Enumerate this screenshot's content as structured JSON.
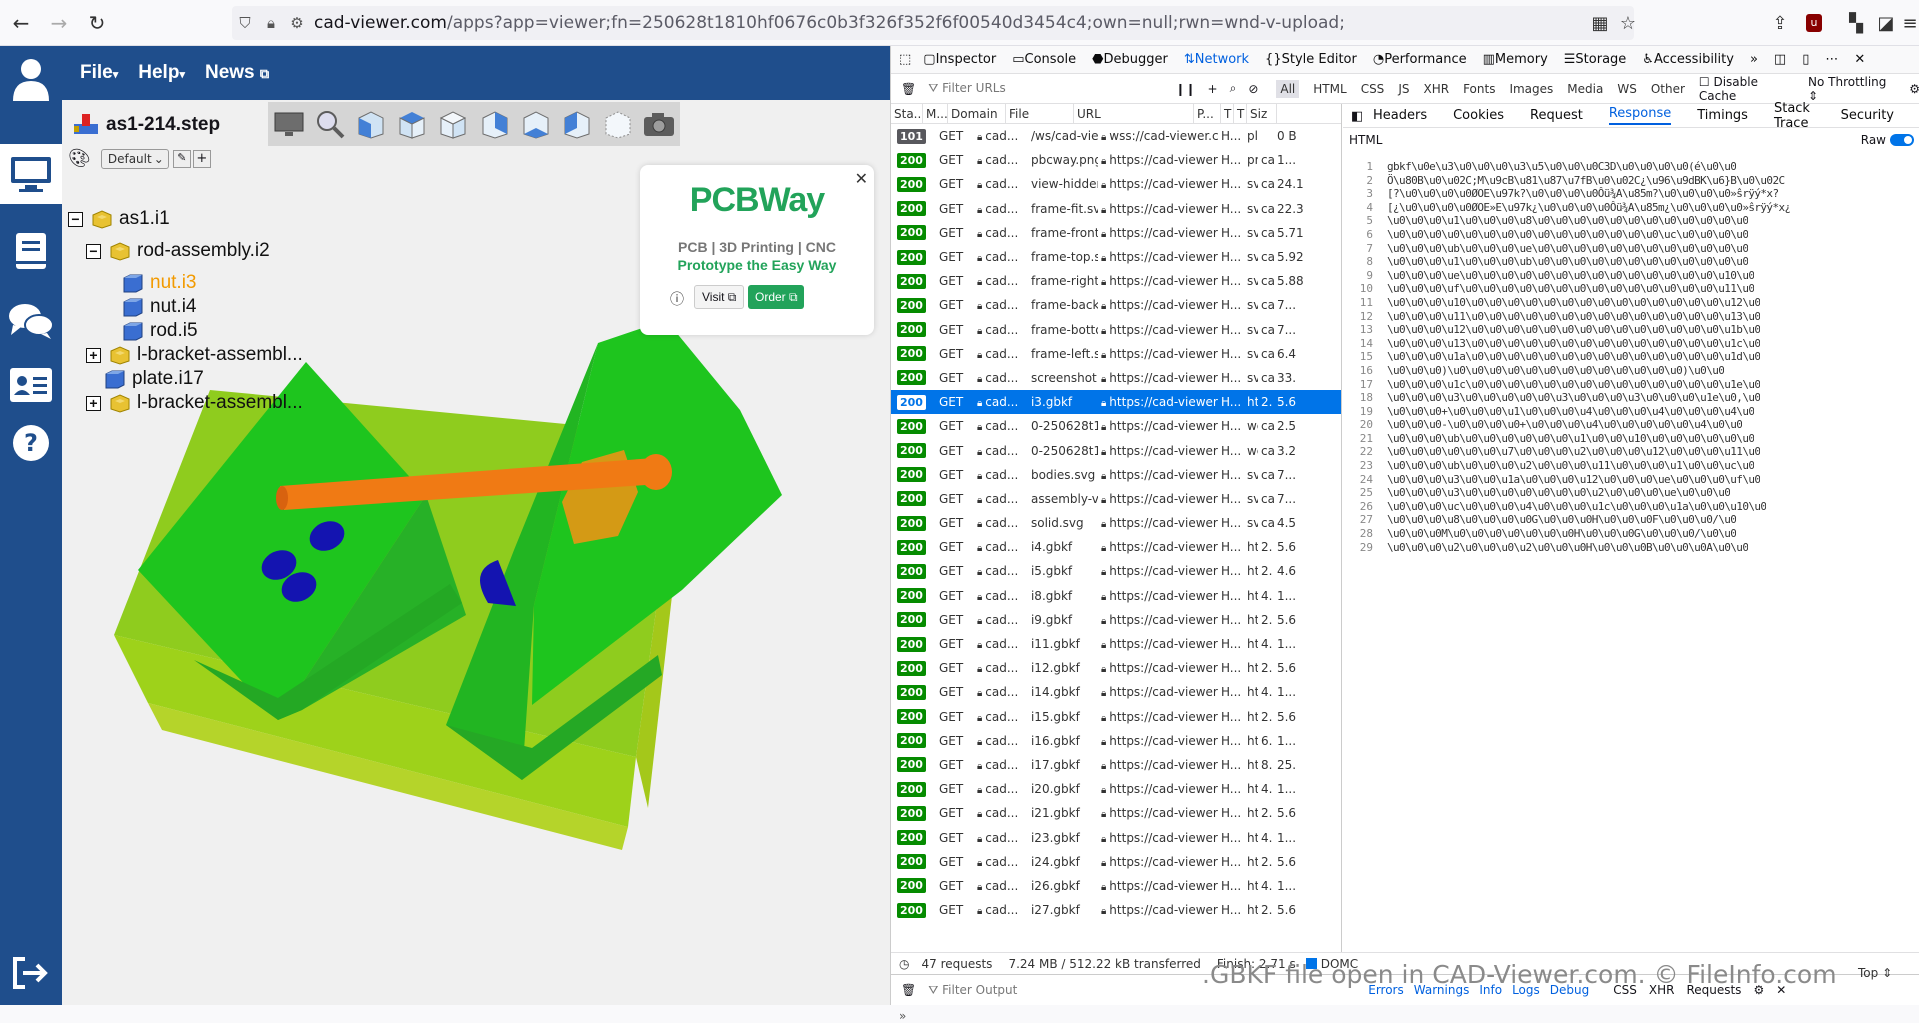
{
  "browser": {
    "url_host": "cad-viewer.com",
    "url_rest": "/apps?app=viewer;fn=250628t1810hf0676c0b3f326f352f6f00540d3454c4;own=null;rwn=wnd-v-upload;"
  },
  "app": {
    "menu": [
      {
        "label": "File"
      },
      {
        "label": "Help"
      },
      {
        "label": "News"
      }
    ],
    "file_name": "as1-214.step",
    "style_select": "Default",
    "tree": [
      {
        "label": "as1.i1"
      },
      {
        "label": "rod-assembly.i2"
      },
      {
        "label": "nut.i3"
      },
      {
        "label": "nut.i4"
      },
      {
        "label": "rod.i5"
      },
      {
        "label": "l-bracket-assembl..."
      },
      {
        "label": "plate.i17"
      },
      {
        "label": "l-bracket-assembl..."
      }
    ],
    "ad": {
      "brand": "PCBWay",
      "tagline1": "PCB | 3D Printing | CNC",
      "tagline2": "Prototype the Easy Way",
      "visit": "Visit",
      "order": "Order"
    }
  },
  "devtools": {
    "tabs": [
      "Inspector",
      "Console",
      "Debugger",
      "Network",
      "Style Editor",
      "Performance",
      "Memory",
      "Storage",
      "Accessibility"
    ],
    "selected_tab": "Network",
    "filter_placeholder": "Filter URLs",
    "type_filters": [
      "All",
      "HTML",
      "CSS",
      "JS",
      "XHR",
      "Fonts",
      "Images",
      "Media",
      "WS",
      "Other"
    ],
    "disable_cache": "Disable Cache",
    "throttling": "No Throttling",
    "columns": [
      "Sta...",
      "M...",
      "Domain",
      "File",
      "URL",
      "P...",
      "T",
      "T",
      "Siz"
    ],
    "requests": [
      {
        "status": "101",
        "method": "GET",
        "domain": "cad...",
        "file": "/ws/cad-viewe",
        "url": "wss://cad-viewer.co...",
        "p": "H...",
        "t1": "pl",
        "t2": "",
        "size": "0 B"
      },
      {
        "status": "200",
        "method": "GET",
        "domain": "cad...",
        "file": "pbcway.png",
        "url": "https://cad-viewer.co...",
        "p": "H...",
        "t1": "pr",
        "t2": "ca",
        "size": "1..."
      },
      {
        "status": "200",
        "method": "GET",
        "domain": "cad...",
        "file": "view-hidden.sv",
        "url": "https://cad-viewer.co...",
        "p": "H...",
        "t1": "sv",
        "t2": "ca",
        "size": "24.1"
      },
      {
        "status": "200",
        "method": "GET",
        "domain": "cad...",
        "file": "frame-fit.svg",
        "url": "https://cad-viewer.co...",
        "p": "H...",
        "t1": "sv",
        "t2": "ca",
        "size": "22.3"
      },
      {
        "status": "200",
        "method": "GET",
        "domain": "cad...",
        "file": "frame-front.svc",
        "url": "https://cad-viewer.co...",
        "p": "H...",
        "t1": "sv",
        "t2": "ca",
        "size": "5.71"
      },
      {
        "status": "200",
        "method": "GET",
        "domain": "cad...",
        "file": "frame-top.svg",
        "url": "https://cad-viewer.co...",
        "p": "H...",
        "t1": "sv",
        "t2": "ca",
        "size": "5.92"
      },
      {
        "status": "200",
        "method": "GET",
        "domain": "cad...",
        "file": "frame-right.svg",
        "url": "https://cad-viewer.co...",
        "p": "H...",
        "t1": "sv",
        "t2": "ca",
        "size": "5.88"
      },
      {
        "status": "200",
        "method": "GET",
        "domain": "cad...",
        "file": "frame-back.sv",
        "url": "https://cad-viewer.co...",
        "p": "H...",
        "t1": "sv",
        "t2": "ca",
        "size": "7..."
      },
      {
        "status": "200",
        "method": "GET",
        "domain": "cad...",
        "file": "frame-bottom.:",
        "url": "https://cad-viewer.co...",
        "p": "H...",
        "t1": "sv",
        "t2": "ca",
        "size": "7..."
      },
      {
        "status": "200",
        "method": "GET",
        "domain": "cad...",
        "file": "frame-left.svg",
        "url": "https://cad-viewer.co...",
        "p": "H...",
        "t1": "sv",
        "t2": "ca",
        "size": "6.4"
      },
      {
        "status": "200",
        "method": "GET",
        "domain": "cad...",
        "file": "screenshot.svg",
        "url": "https://cad-viewer.co...",
        "p": "H...",
        "t1": "sv",
        "t2": "ca",
        "size": "33."
      },
      {
        "status": "200",
        "method": "GET",
        "domain": "cad...",
        "file": "i3.gbkf",
        "url": "https://cad-viewer.co...",
        "p": "H...",
        "t1": "ht",
        "t2": "2.",
        "size": "5.6",
        "sel": true
      },
      {
        "status": "200",
        "method": "GET",
        "domain": "cad...",
        "file": "0-250628t1810",
        "url": "https://cad-viewer.co...",
        "p": "H...",
        "t1": "we",
        "t2": "ca",
        "size": "2.5"
      },
      {
        "status": "200",
        "method": "GET",
        "domain": "cad...",
        "file": "0-250628t1810",
        "url": "https://cad-viewer.co...",
        "p": "H...",
        "t1": "we",
        "t2": "ca",
        "size": "3.2"
      },
      {
        "status": "200",
        "method": "GET",
        "domain": "cad...",
        "file": "bodies.svg",
        "url": "https://cad-viewer.co...",
        "p": "H...",
        "t1": "sv",
        "t2": "ca",
        "size": "7..."
      },
      {
        "status": "200",
        "method": "GET",
        "domain": "cad...",
        "file": "assembly-virtu",
        "url": "https://cad-viewer.co...",
        "p": "H...",
        "t1": "sv",
        "t2": "ca",
        "size": "7..."
      },
      {
        "status": "200",
        "method": "GET",
        "domain": "cad...",
        "file": "solid.svg",
        "url": "https://cad-viewer.co...",
        "p": "H...",
        "t1": "sv",
        "t2": "ca",
        "size": "4.5"
      },
      {
        "status": "200",
        "method": "GET",
        "domain": "cad...",
        "file": "i4.gbkf",
        "url": "https://cad-viewer.co...",
        "p": "H...",
        "t1": "ht",
        "t2": "2.",
        "size": "5.6"
      },
      {
        "status": "200",
        "method": "GET",
        "domain": "cad...",
        "file": "i5.gbkf",
        "url": "https://cad-viewer.co...",
        "p": "H...",
        "t1": "ht",
        "t2": "2.",
        "size": "4.6"
      },
      {
        "status": "200",
        "method": "GET",
        "domain": "cad...",
        "file": "i8.gbkf",
        "url": "https://cad-viewer.co...",
        "p": "H...",
        "t1": "ht",
        "t2": "4.",
        "size": "1..."
      },
      {
        "status": "200",
        "method": "GET",
        "domain": "cad...",
        "file": "i9.gbkf",
        "url": "https://cad-viewer.co...",
        "p": "H...",
        "t1": "ht",
        "t2": "2.",
        "size": "5.6"
      },
      {
        "status": "200",
        "method": "GET",
        "domain": "cad...",
        "file": "i11.gbkf",
        "url": "https://cad-viewer.co...",
        "p": "H...",
        "t1": "ht",
        "t2": "4.",
        "size": "1..."
      },
      {
        "status": "200",
        "method": "GET",
        "domain": "cad...",
        "file": "i12.gbkf",
        "url": "https://cad-viewer.co...",
        "p": "H...",
        "t1": "ht",
        "t2": "2.",
        "size": "5.6"
      },
      {
        "status": "200",
        "method": "GET",
        "domain": "cad...",
        "file": "i14.gbkf",
        "url": "https://cad-viewer.co...",
        "p": "H...",
        "t1": "ht",
        "t2": "4.",
        "size": "1..."
      },
      {
        "status": "200",
        "method": "GET",
        "domain": "cad...",
        "file": "i15.gbkf",
        "url": "https://cad-viewer.co...",
        "p": "H...",
        "t1": "ht",
        "t2": "2.",
        "size": "5.6"
      },
      {
        "status": "200",
        "method": "GET",
        "domain": "cad...",
        "file": "i16.gbkf",
        "url": "https://cad-viewer.co...",
        "p": "H...",
        "t1": "ht",
        "t2": "6.",
        "size": "1..."
      },
      {
        "status": "200",
        "method": "GET",
        "domain": "cad...",
        "file": "i17.gbkf",
        "url": "https://cad-viewer.co...",
        "p": "H...",
        "t1": "ht",
        "t2": "8.",
        "size": "25."
      },
      {
        "status": "200",
        "method": "GET",
        "domain": "cad...",
        "file": "i20.gbkf",
        "url": "https://cad-viewer.co...",
        "p": "H...",
        "t1": "ht",
        "t2": "4.",
        "size": "1..."
      },
      {
        "status": "200",
        "method": "GET",
        "domain": "cad...",
        "file": "i21.gbkf",
        "url": "https://cad-viewer.co...",
        "p": "H...",
        "t1": "ht",
        "t2": "2.",
        "size": "5.6"
      },
      {
        "status": "200",
        "method": "GET",
        "domain": "cad...",
        "file": "i23.gbkf",
        "url": "https://cad-viewer.co...",
        "p": "H...",
        "t1": "ht",
        "t2": "4.",
        "size": "1..."
      },
      {
        "status": "200",
        "method": "GET",
        "domain": "cad...",
        "file": "i24.gbkf",
        "url": "https://cad-viewer.co...",
        "p": "H...",
        "t1": "ht",
        "t2": "2.",
        "size": "5.6"
      },
      {
        "status": "200",
        "method": "GET",
        "domain": "cad...",
        "file": "i26.gbkf",
        "url": "https://cad-viewer.co...",
        "p": "H...",
        "t1": "ht",
        "t2": "4.",
        "size": "1..."
      },
      {
        "status": "200",
        "method": "GET",
        "domain": "cad...",
        "file": "i27.gbkf",
        "url": "https://cad-viewer.co...",
        "p": "H...",
        "t1": "ht",
        "t2": "2.",
        "size": "5.6"
      }
    ],
    "response_tabs": [
      "Headers",
      "Cookies",
      "Request",
      "Response",
      "Timings",
      "Stack Trace",
      "Security"
    ],
    "response_selected": "Response",
    "response_label": "HTML",
    "raw_label": "Raw",
    "code_lines": [
      "gbkf\\u0e\\u3\\u0\\u0\\u0\\u3\\u5\\u0\\u0\\u0C3D\\u0\\u0\\u0\\u0(é\\u0\\u0",
      "Ö\\u80B\\u0\\u02C;M\\u9cB\\u81\\u87\\u7fB\\u0\\u02C¿\\u96\\u9dBK\\u6}B\\u0\\u02C",
      "[?\\u0\\u0\\u0\\u0ØOE\\u97k?\\u0\\u0\\u0\\u0Ôü¾A\\u85m?\\u0\\u0\\u0\\u0»ŝrÿý*x?",
      "[¿\\u0\\u0\\u0\\u0ØOE»E\\u97k¿\\u0\\u0\\u0\\u0Ôü¾A\\u85m¿\\u0\\u0\\u0\\u0»ŝrÿý*x¿",
      "\\u0\\u0\\u0\\u1\\u0\\u0\\u0\\u8\\u0\\u0\\u0\\u0\\u0\\u0\\u0\\u0\\u0\\u0\\u0\\u0",
      "\\u0\\u0\\u0\\u0\\u0\\u0\\u0\\u0\\u0\\u0\\u0\\u0\\u0\\u0\\u0\\uc\\u0\\u0\\u0\\u0",
      "\\u0\\u0\\u0\\ub\\u0\\u0\\u0\\ue\\u0\\u0\\u0\\u0\\u0\\u0\\u0\\u0\\u0\\u0\\u0\\u0",
      "\\u0\\u0\\u0\\u1\\u0\\u0\\u0\\ub\\u0\\u0\\u0\\u0\\u0\\u0\\u0\\u0\\u0\\u0\\u0\\u0",
      "\\u0\\u0\\u0\\ue\\u0\\u0\\u0\\u0\\u0\\u0\\u0\\u0\\u0\\u0\\u0\\u0\\u0\\u0\\u10\\u0",
      "\\u0\\u0\\u0\\uf\\u0\\u0\\u0\\u0\\u0\\u0\\u0\\u0\\u0\\u0\\u0\\u0\\u0\\u0\\u11\\u0",
      "\\u0\\u0\\u0\\u10\\u0\\u0\\u0\\u0\\u0\\u0\\u0\\u0\\u0\\u0\\u0\\u0\\u0\\u0\\u12\\u0",
      "\\u0\\u0\\u0\\u11\\u0\\u0\\u0\\u0\\u0\\u0\\u0\\u0\\u0\\u0\\u0\\u0\\u0\\u0\\u13\\u0",
      "\\u0\\u0\\u0\\u12\\u0\\u0\\u0\\u0\\u0\\u0\\u0\\u0\\u0\\u0\\u0\\u0\\u0\\u0\\u1b\\u0",
      "\\u0\\u0\\u0\\u13\\u0\\u0\\u0\\u0\\u0\\u0\\u0\\u0\\u0\\u0\\u0\\u0\\u0\\u0\\u1c\\u0",
      "\\u0\\u0\\u0\\u1a\\u0\\u0\\u0\\u0\\u0\\u0\\u0\\u0\\u0\\u0\\u0\\u0\\u0\\u0\\u1d\\u0",
      "\\u0\\u0\\u0)\\u0\\u0\\u0\\u0\\u0\\u0\\u0\\u0\\u0\\u0\\u0\\u0\\u0)\\u0\\u0",
      "\\u0\\u0\\u0\\u1c\\u0\\u0\\u0\\u0\\u0\\u0\\u0\\u0\\u0\\u0\\u0\\u0\\u0\\u0\\u1e\\u0",
      "\\u0\\u0\\u0\\u3\\u0\\u0\\u0\\u0\\u0\\u3\\u0\\u0\\u0\\u3\\u0\\u0\\u0\\u1e\\u0,\\u0",
      "\\u0\\u0\\u0+\\u0\\u0\\u0\\u1\\u0\\u0\\u0\\u4\\u0\\u0\\u0\\u4\\u0\\u0\\u0\\u4\\u0",
      "\\u0\\u0\\u0-\\u0\\u0\\u0\\u0+\\u0\\u0\\u0\\u4\\u0\\u0\\u0\\u0\\u0\\u4\\u0\\u0",
      "\\u0\\u0\\u0\\ub\\u0\\u0\\u0\\u0\\u0\\u0\\u1\\u0\\u0\\u10\\u0\\u0\\u0\\u0\\u0\\u0",
      "\\u0\\u0\\u0\\u0\\u0\\u0\\u7\\u0\\u0\\u0\\u2\\u0\\u0\\u0\\u12\\u0\\u0\\u0\\u11\\u0",
      "\\u0\\u0\\u0\\ub\\u0\\u0\\u0\\u2\\u0\\u0\\u0\\u11\\u0\\u0\\u0\\u1\\u0\\u0\\uc\\u0",
      "\\u0\\u0\\u0\\u3\\u0\\u0\\u1a\\u0\\u0\\u0\\u12\\u0\\u0\\u0\\ue\\u0\\u0\\u0\\uf\\u0",
      "\\u0\\u0\\u0\\u3\\u0\\u0\\u0\\u0\\u0\\u0\\u0\\u2\\u0\\u0\\u0\\ue\\u0\\u0\\u0",
      "\\u0\\u0\\u0\\uc\\u0\\u0\\u0\\u4\\u0\\u0\\u0\\u1c\\u0\\u0\\u0\\u1a\\u0\\u0\\u10\\u0",
      "\\u0\\u0\\u0\\u8\\u0\\u0\\u0\\u0G\\u0\\u0\\u0H\\u0\\u0\\u0F\\u0\\u0\\u0/\\u0",
      "\\u0\\u0\\u0M\\u0\\u0\\u0\\u0\\u0\\u0\\u0H\\u0\\u0\\u0G\\u0\\u0\\u0/\\u0\\u0",
      "\\u0\\u0\\u0\\u2\\u0\\u0\\u0\\u2\\u0\\u0\\u0H\\u0\\u0\\u0B\\u0\\u0\\u0A\\u0\\u0"
    ],
    "status": {
      "requests": "47 requests",
      "transferred": "7.24 MB / 512.22 kB transferred",
      "finish": "Finish: 2.71 s",
      "domc": "DOMC"
    },
    "console": {
      "filter_placeholder": "Filter Output",
      "levels": [
        "Errors",
        "Warnings",
        "Info",
        "Logs",
        "Debug"
      ],
      "types": [
        "CSS",
        "XHR",
        "Requests"
      ],
      "top": "Top"
    }
  },
  "watermark": ".GBKF file open in CAD-Viewer.com. © FileInfo.com"
}
